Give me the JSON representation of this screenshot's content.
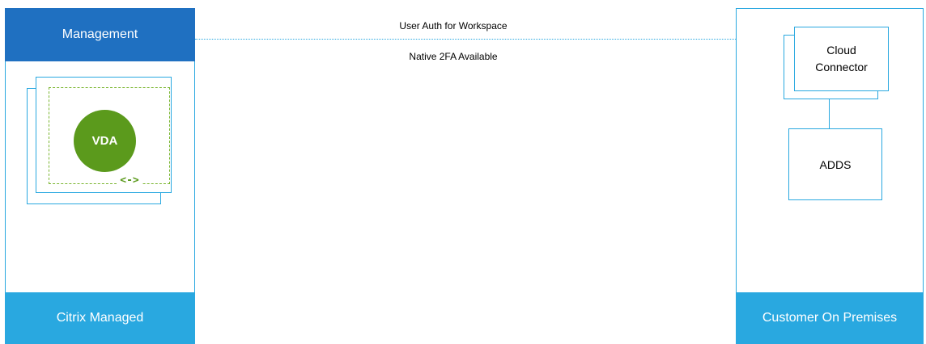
{
  "left_panel": {
    "header": "Management",
    "footer": "Citrix Managed",
    "vda_label": "VDA",
    "resize_glyph": "<->"
  },
  "connection": {
    "label_top": "User Auth for Workspace",
    "label_bottom": "Native 2FA Available"
  },
  "right_panel": {
    "cloud_connector_line1": "Cloud",
    "cloud_connector_line2": "Connector",
    "adds_label": "ADDS",
    "footer": "Customer On Premises"
  },
  "colors": {
    "management_blue": "#1f70c1",
    "footer_cyan": "#29a8e0",
    "vda_green": "#5b9a1c"
  }
}
